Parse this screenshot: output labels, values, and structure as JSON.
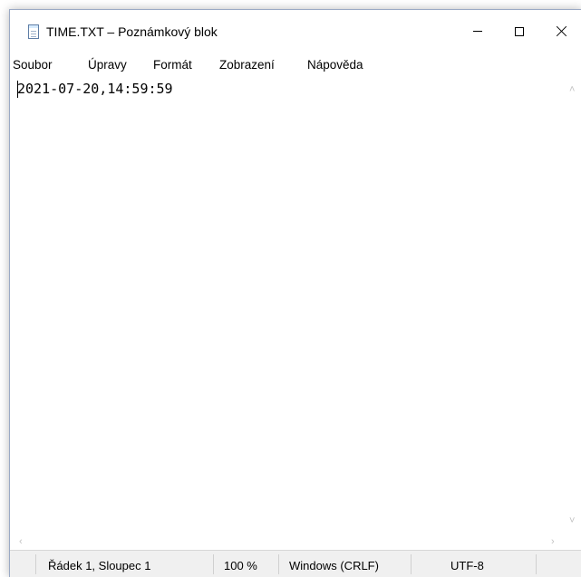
{
  "window": {
    "title": "TIME.TXT – Poznámkový blok",
    "app_icon": "notepad-icon",
    "controls": {
      "minimize_icon": "minimize-icon",
      "maximize_icon": "maximize-icon",
      "close_icon": "close-icon"
    }
  },
  "menu": {
    "items": [
      "Soubor",
      "Úpravy",
      "Formát",
      "Zobrazení",
      "Nápověda"
    ]
  },
  "editor": {
    "content": "2021-07-20,14:59:59"
  },
  "scrollbars": {
    "vertical": {
      "up_icon": "chevron-up-icon",
      "down_icon": "chevron-down-icon"
    },
    "horizontal": {
      "left_icon": "chevron-left-icon",
      "right_icon": "chevron-right-icon"
    }
  },
  "status": {
    "position": "Řádek 1, Sloupec 1",
    "zoom": "100 %",
    "line_endings": "Windows (CRLF)",
    "encoding": "UTF-8"
  },
  "colors": {
    "window_bg": "#ffffff",
    "statusbar_bg": "#f0f0f0",
    "border": "#9aa9c4"
  }
}
